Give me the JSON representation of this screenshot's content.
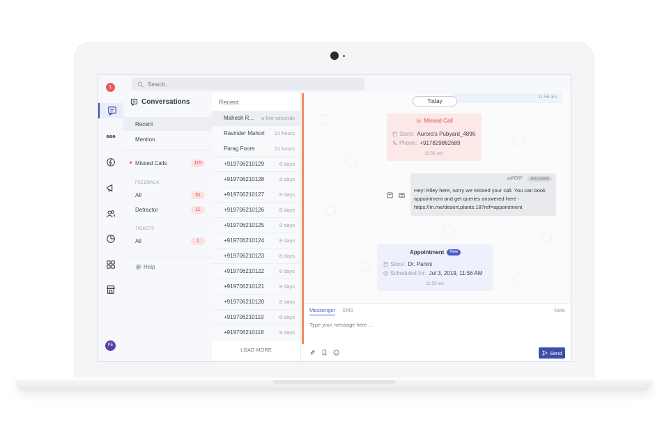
{
  "rail": {
    "notification_count": "1",
    "avatar_initials": "PE"
  },
  "search": {
    "placeholder": "Search..."
  },
  "conversations": {
    "title": "Conversations",
    "recent_label": "Recent",
    "mention_label": "Mention",
    "missed_calls_label": "Missed Calls",
    "missed_calls_count": "115",
    "feedback_section": "FEEDBACK",
    "feedback_all_label": "All",
    "feedback_all_count": "31",
    "detractor_label": "Detractor",
    "detractor_count": "11",
    "tickets_section": "TICKETS",
    "tickets_all_label": "All",
    "tickets_all_count": "1",
    "help_label": "Help"
  },
  "recent": {
    "header": "Recent",
    "load_more": "LOAD MORE",
    "rows": [
      {
        "name": "Mahesh R...",
        "time": "a few seconds"
      },
      {
        "name": "Ravinder Mahori",
        "time": "21 hours"
      },
      {
        "name": "Parag Foore",
        "time": "21 hours"
      },
      {
        "name": "+919706210129",
        "time": "6 days"
      },
      {
        "name": "+919706210128",
        "time": "8 days"
      },
      {
        "name": "+919706210127",
        "time": "8 days"
      },
      {
        "name": "+919706210126",
        "time": "8 days"
      },
      {
        "name": "+919706210125",
        "time": "8 days"
      },
      {
        "name": "+919706210124",
        "time": "8 days"
      },
      {
        "name": "+919706210123",
        "time": "8 days"
      },
      {
        "name": "+919706210122",
        "time": "8 days"
      },
      {
        "name": "+919706210121",
        "time": "8 days"
      },
      {
        "name": "+919706210120",
        "time": "8 days"
      },
      {
        "name": "+919706210119",
        "time": "8 days"
      },
      {
        "name": "+919706210118",
        "time": "8 days"
      }
    ]
  },
  "chat": {
    "day_label": "Today",
    "top_time": "11:56 am",
    "missed_call": {
      "title": "Missed Call",
      "store_key": "Store:",
      "store_value": "Aurora's Pubyard_4896",
      "phone_key": "Phone:",
      "phone_value": "+917829862689",
      "time": "11:56 am"
    },
    "bot_message": {
      "from": "ooPERF",
      "tag": "Automated",
      "text": "Hey! Riley here, sorry we missed your call. You can book appointment and get queries answered here - https://m.me/desert.plants.18?ref=appointment"
    },
    "appointment": {
      "title": "Appointment",
      "badge": "New",
      "store_key": "Store:",
      "store_value": "Dr. Panini",
      "scheduled_key": "Scheduled for:",
      "scheduled_value": "Jul 3, 2019, 11:56 AM",
      "time": "11:56 am"
    }
  },
  "composer": {
    "tab_messenger": "Messenger",
    "tab_sms": "SMS",
    "note_label": "Note",
    "placeholder": "Type your message here ...",
    "send_label": "Send"
  },
  "colors": {
    "accent": "#3b4fa8",
    "missed_bg": "#fde8e8",
    "alert": "#e14d4d",
    "highlight_bar": "#f08a5d"
  }
}
